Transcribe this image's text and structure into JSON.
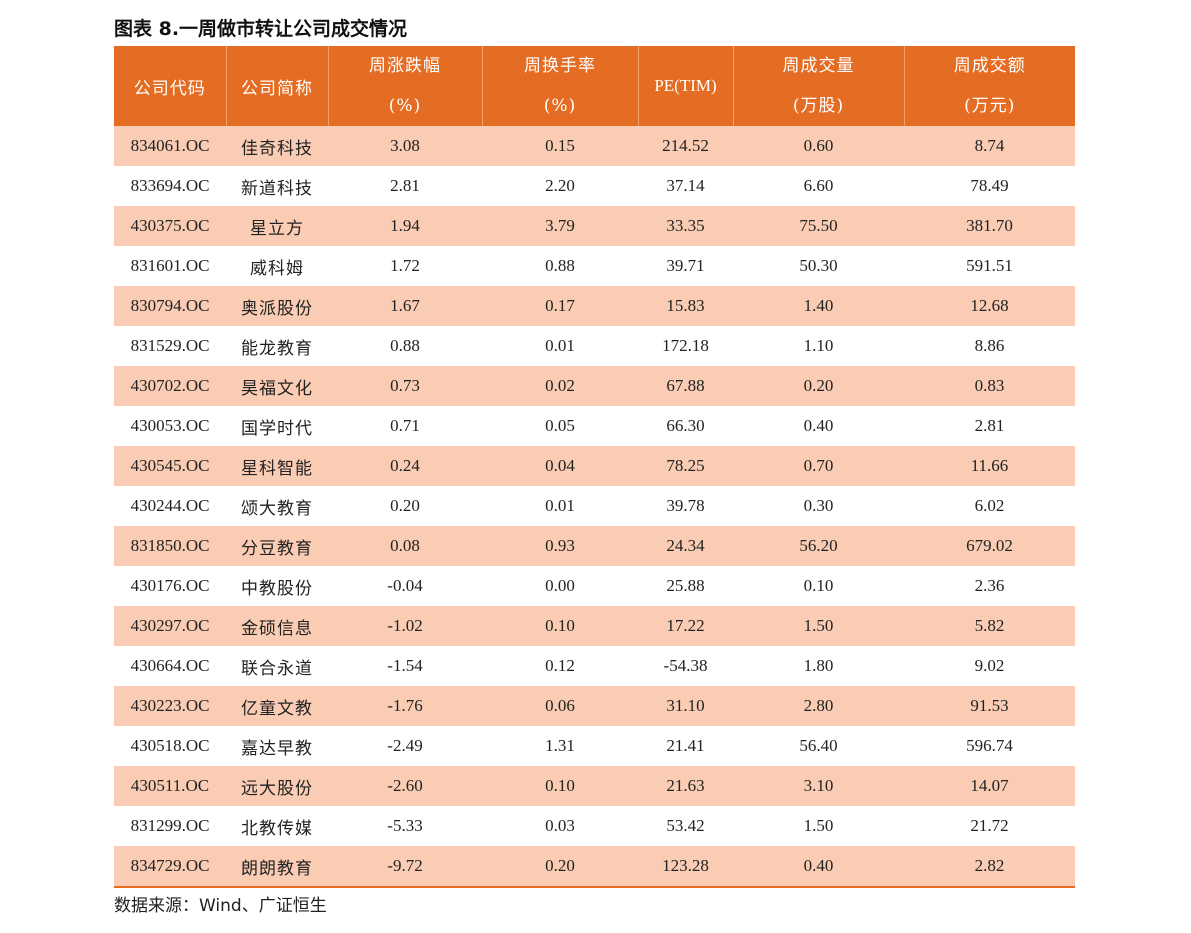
{
  "title": "图表 8.一周做市转让公司成交情况",
  "header": {
    "code": "公司代码",
    "name": "公司简称",
    "chg_l1": "周涨跌幅",
    "chg_l2": "(%)",
    "turn_l1": "周换手率",
    "turn_l2": "(%)",
    "pe": "PE(TIM)",
    "vol_l1": "周成交量",
    "vol_l2": "(万股)",
    "amt_l1": "周成交额",
    "amt_l2": "(万元)"
  },
  "rows": [
    {
      "code": "834061.OC",
      "name": "佳奇科技",
      "chg": "3.08",
      "turn": "0.15",
      "pe": "214.52",
      "vol": "0.60",
      "amt": "8.74"
    },
    {
      "code": "833694.OC",
      "name": "新道科技",
      "chg": "2.81",
      "turn": "2.20",
      "pe": "37.14",
      "vol": "6.60",
      "amt": "78.49"
    },
    {
      "code": "430375.OC",
      "name": "星立方",
      "chg": "1.94",
      "turn": "3.79",
      "pe": "33.35",
      "vol": "75.50",
      "amt": "381.70"
    },
    {
      "code": "831601.OC",
      "name": "威科姆",
      "chg": "1.72",
      "turn": "0.88",
      "pe": "39.71",
      "vol": "50.30",
      "amt": "591.51"
    },
    {
      "code": "830794.OC",
      "name": "奥派股份",
      "chg": "1.67",
      "turn": "0.17",
      "pe": "15.83",
      "vol": "1.40",
      "amt": "12.68"
    },
    {
      "code": "831529.OC",
      "name": "能龙教育",
      "chg": "0.88",
      "turn": "0.01",
      "pe": "172.18",
      "vol": "1.10",
      "amt": "8.86"
    },
    {
      "code": "430702.OC",
      "name": "昊福文化",
      "chg": "0.73",
      "turn": "0.02",
      "pe": "67.88",
      "vol": "0.20",
      "amt": "0.83"
    },
    {
      "code": "430053.OC",
      "name": "国学时代",
      "chg": "0.71",
      "turn": "0.05",
      "pe": "66.30",
      "vol": "0.40",
      "amt": "2.81"
    },
    {
      "code": "430545.OC",
      "name": "星科智能",
      "chg": "0.24",
      "turn": "0.04",
      "pe": "78.25",
      "vol": "0.70",
      "amt": "11.66"
    },
    {
      "code": "430244.OC",
      "name": "颂大教育",
      "chg": "0.20",
      "turn": "0.01",
      "pe": "39.78",
      "vol": "0.30",
      "amt": "6.02"
    },
    {
      "code": "831850.OC",
      "name": "分豆教育",
      "chg": "0.08",
      "turn": "0.93",
      "pe": "24.34",
      "vol": "56.20",
      "amt": "679.02"
    },
    {
      "code": "430176.OC",
      "name": "中教股份",
      "chg": "-0.04",
      "turn": "0.00",
      "pe": "25.88",
      "vol": "0.10",
      "amt": "2.36"
    },
    {
      "code": "430297.OC",
      "name": "金硕信息",
      "chg": "-1.02",
      "turn": "0.10",
      "pe": "17.22",
      "vol": "1.50",
      "amt": "5.82"
    },
    {
      "code": "430664.OC",
      "name": "联合永道",
      "chg": "-1.54",
      "turn": "0.12",
      "pe": "-54.38",
      "vol": "1.80",
      "amt": "9.02"
    },
    {
      "code": "430223.OC",
      "name": "亿童文教",
      "chg": "-1.76",
      "turn": "0.06",
      "pe": "31.10",
      "vol": "2.80",
      "amt": "91.53"
    },
    {
      "code": "430518.OC",
      "name": "嘉达早教",
      "chg": "-2.49",
      "turn": "1.31",
      "pe": "21.41",
      "vol": "56.40",
      "amt": "596.74"
    },
    {
      "code": "430511.OC",
      "name": "远大股份",
      "chg": "-2.60",
      "turn": "0.10",
      "pe": "21.63",
      "vol": "3.10",
      "amt": "14.07"
    },
    {
      "code": "831299.OC",
      "name": "北教传媒",
      "chg": "-5.33",
      "turn": "0.03",
      "pe": "53.42",
      "vol": "1.50",
      "amt": "21.72"
    },
    {
      "code": "834729.OC",
      "name": "朗朗教育",
      "chg": "-9.72",
      "turn": "0.20",
      "pe": "123.28",
      "vol": "0.40",
      "amt": "2.82"
    }
  ],
  "source": "数据来源：Wind、广证恒生",
  "colors": {
    "header_bg": "#e46c23",
    "row_shade": "#f9ccb3"
  }
}
